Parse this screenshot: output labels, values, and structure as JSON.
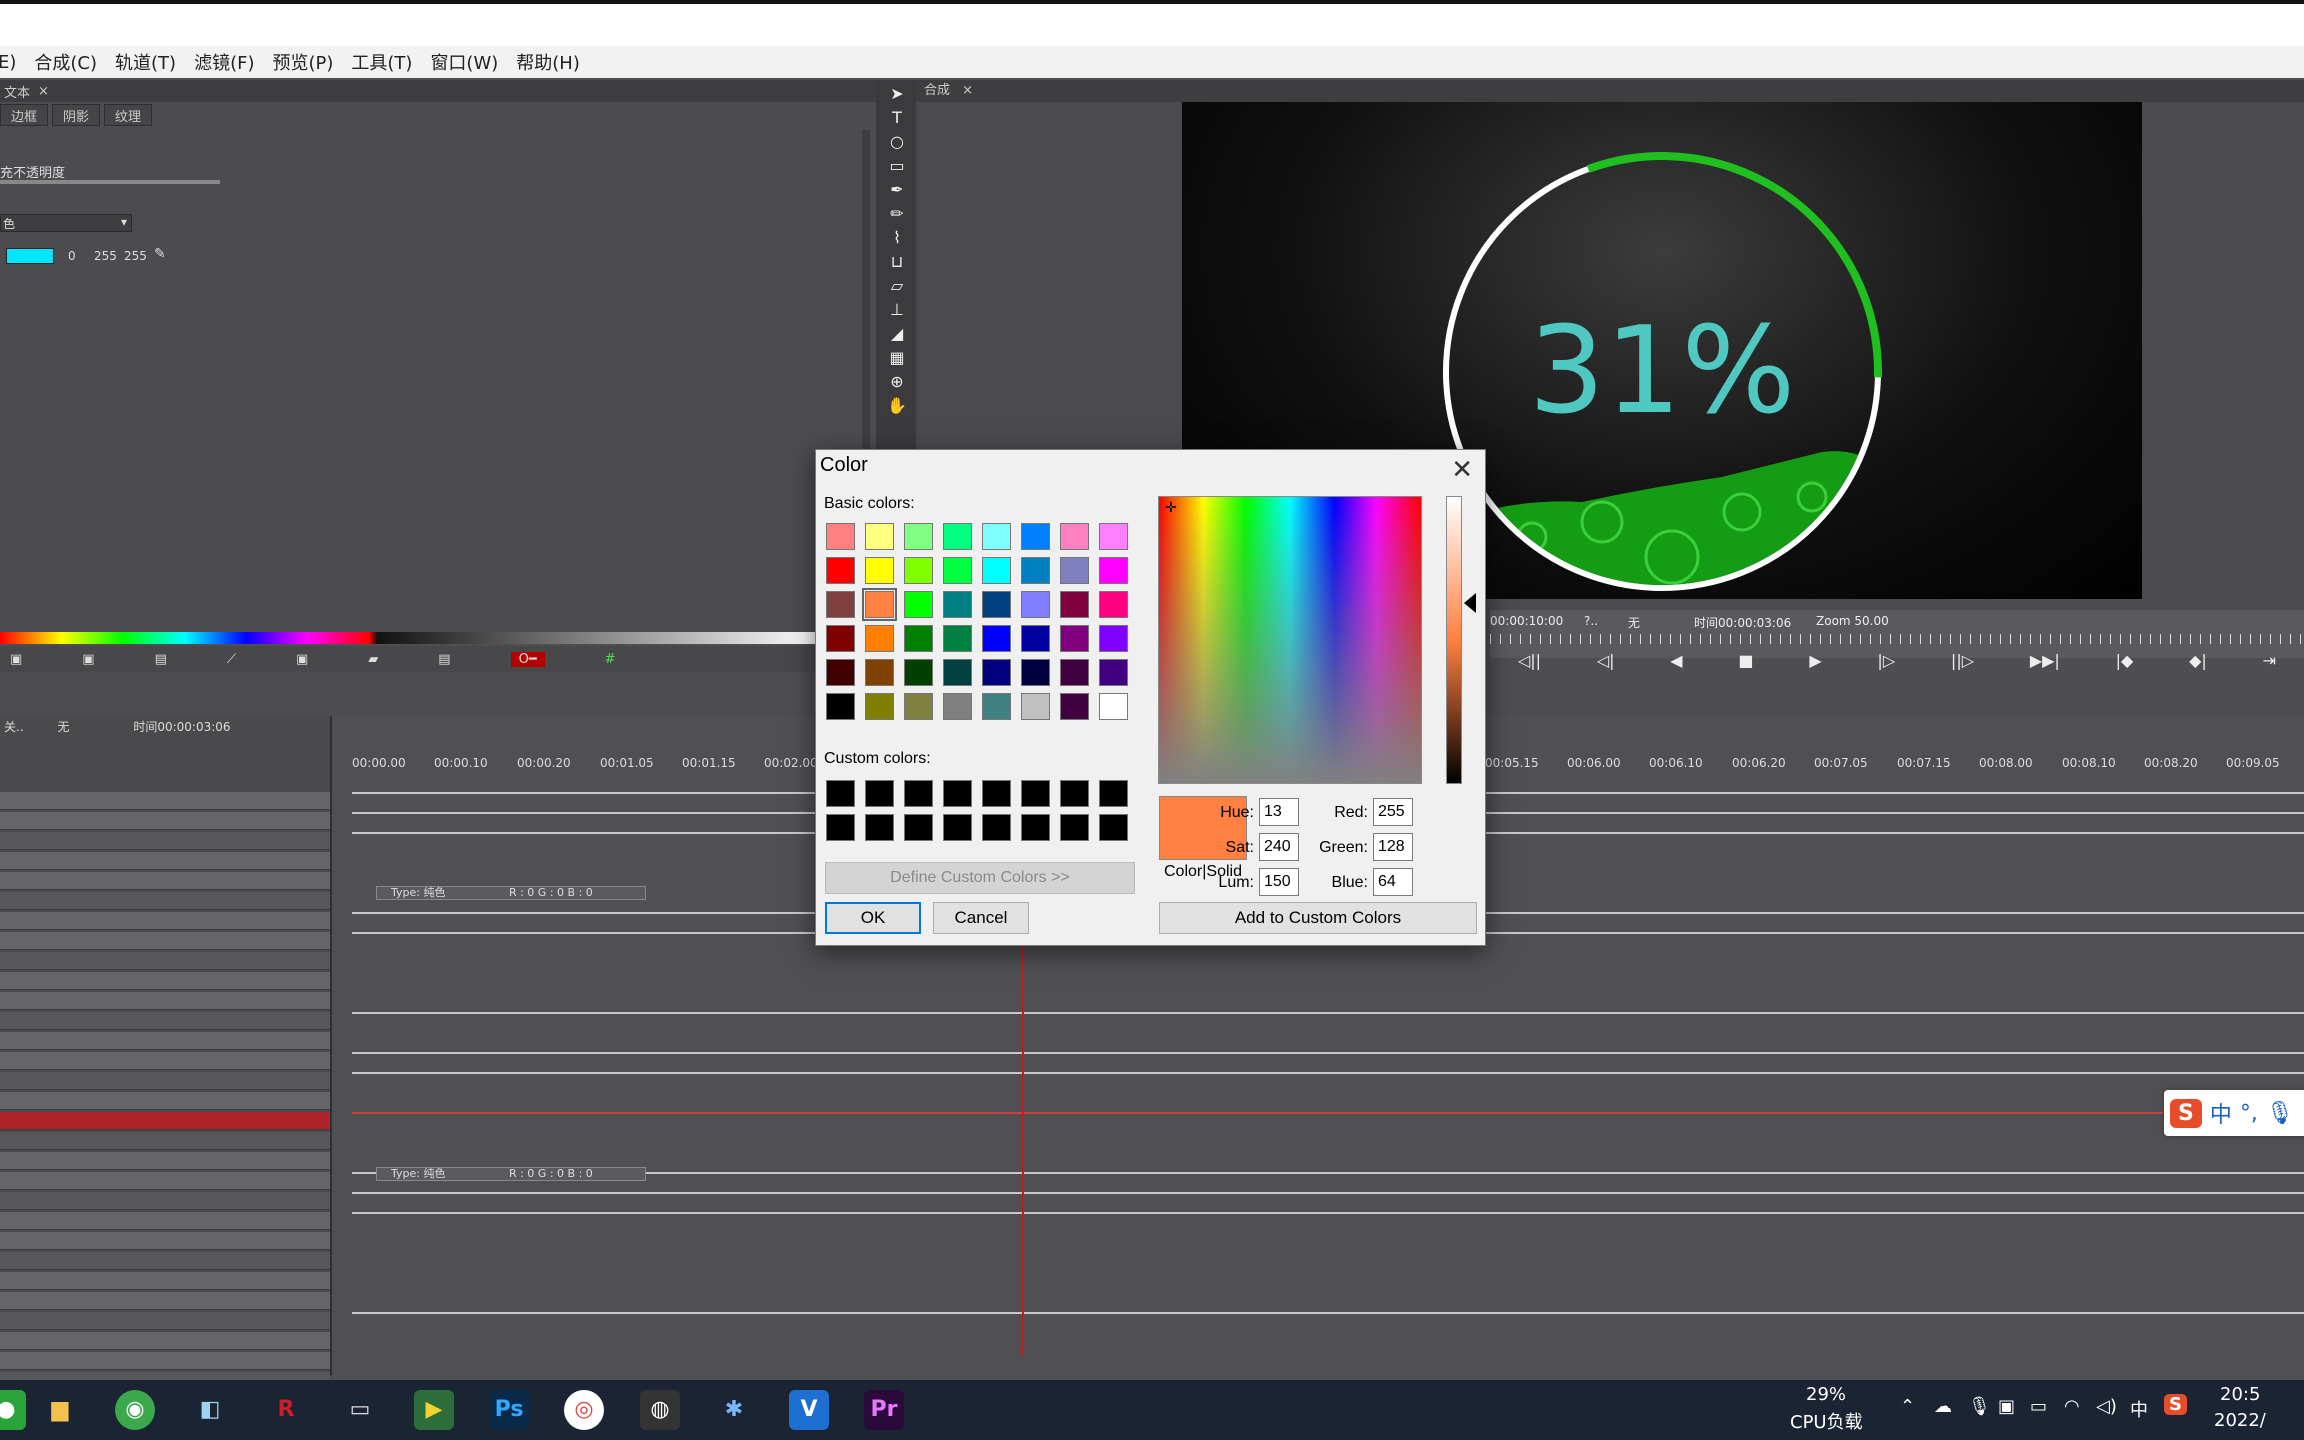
{
  "menu": [
    "E)",
    "合成(C)",
    "轨道(T)",
    "滤镜(F)",
    "预览(P)",
    "工具(T)",
    "窗口(W)",
    "帮助(H)"
  ],
  "text_panel": {
    "title": "文本",
    "tabs": [
      "边框",
      "阴影",
      "纹理"
    ],
    "opacity_label": "充不透明度",
    "fill_type": "色",
    "rgb": [
      "0",
      "255",
      "255"
    ],
    "swatch_color": "#00e5ff"
  },
  "comp_panel": {
    "title": "合成"
  },
  "preview": {
    "percent_text": "31%",
    "ring_color": "#1fbf1f",
    "text_color": "#4ec8c0"
  },
  "ruler_info": {
    "left": "00:00:10:00",
    "mid": "?..",
    "none": "无",
    "time": "时间00:00:03:06",
    "zoom": "Zoom  50.00"
  },
  "timeline": {
    "status": {
      "left": "关..",
      "none": "无",
      "time": "时间00:00:03:06"
    },
    "ruler": [
      "00:00.00",
      "00:00.10",
      "00:00.20",
      "00:01.05",
      "00:01.15",
      "00:02.00",
      "00:05.15",
      "00:06.00",
      "00:06.10",
      "00:06.20",
      "00:07.05",
      "00:07.15",
      "00:08.00",
      "00:08.10",
      "00:08.20",
      "00:09.05"
    ],
    "type_tags": [
      "Type:  纯色",
      "R : 0  G : 0  B : 0"
    ]
  },
  "dialog": {
    "title": "Color",
    "basic_colors_label": "Basic colors:",
    "custom_colors_label": "Custom colors:",
    "define_button": "Define Custom Colors >>",
    "ok_button": "OK",
    "cancel_button": "Cancel",
    "add_custom_button": "Add to Custom Colors",
    "color_solid_label": "Color|Solid",
    "fields": {
      "hue_label": "Hue:",
      "hue": "13",
      "sat_label": "Sat:",
      "sat": "240",
      "lum_label": "Lum:",
      "lum": "150",
      "red_label": "Red:",
      "red": "255",
      "green_label": "Green:",
      "green": "128",
      "blue_label": "Blue:",
      "blue": "64"
    },
    "selected_color": "#ff8040",
    "basic_colors": [
      "#ff8080",
      "#ffff80",
      "#80ff80",
      "#00ff80",
      "#80ffff",
      "#0080ff",
      "#ff80c0",
      "#ff80ff",
      "#ff0000",
      "#ffff00",
      "#80ff00",
      "#00ff40",
      "#00ffff",
      "#0080c0",
      "#8080c0",
      "#ff00ff",
      "#804040",
      "#ff8040",
      "#00ff00",
      "#008080",
      "#004080",
      "#8080ff",
      "#800040",
      "#ff0080",
      "#800000",
      "#ff8000",
      "#008000",
      "#008040",
      "#0000ff",
      "#0000a0",
      "#800080",
      "#8000ff",
      "#400000",
      "#804000",
      "#004000",
      "#004040",
      "#000080",
      "#000040",
      "#400040",
      "#400080",
      "#000000",
      "#808000",
      "#808040",
      "#808080",
      "#408080",
      "#c0c0c0",
      "#400040",
      "#ffffff"
    ],
    "custom_colors": [
      "#000000",
      "#000000",
      "#000000",
      "#000000",
      "#000000",
      "#000000",
      "#000000",
      "#000000",
      "#000000",
      "#000000",
      "#000000",
      "#000000",
      "#000000",
      "#000000",
      "#000000",
      "#000000"
    ]
  },
  "taskbar": {
    "cpu_percent": "29%",
    "cpu_label": "CPU负载",
    "ime": "中",
    "clock_time": "20:5",
    "clock_date": "2022/"
  },
  "ime_bar": {
    "lang": "中"
  }
}
